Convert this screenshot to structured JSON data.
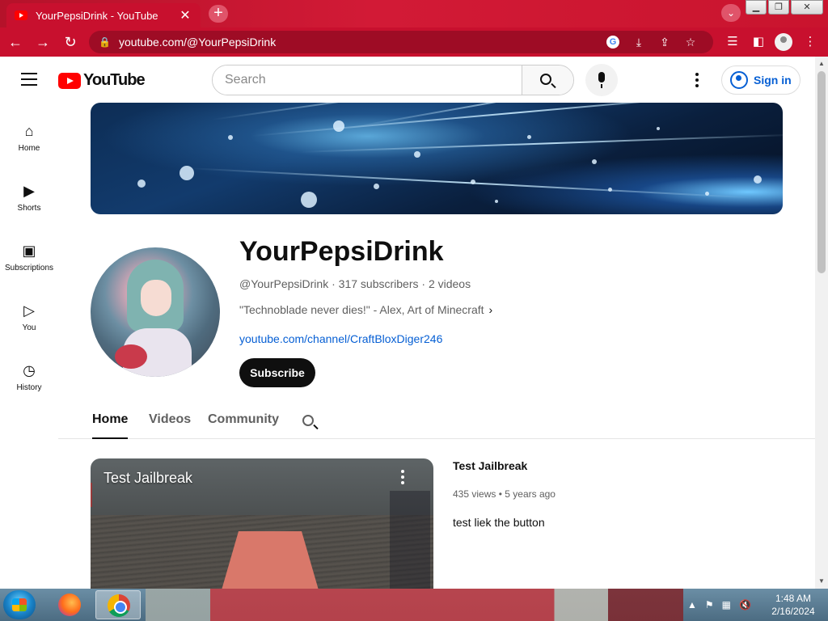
{
  "browser": {
    "tab_title": "YourPepsiDrink - YouTube",
    "tab_close": "✕",
    "new_tab": "+",
    "tab_search": "⌄",
    "window_minimize": "▁",
    "window_restore": "❐",
    "window_close": "✕",
    "url": "youtube.com/@YourPepsiDrink",
    "back": "←",
    "forward": "→",
    "reload": "↻"
  },
  "youtube": {
    "logo_text": "YouTube",
    "search_placeholder": "Search",
    "sign_in": "Sign in",
    "sidebar": [
      {
        "label": "Home",
        "icon": "⌂"
      },
      {
        "label": "Shorts",
        "icon": "▶"
      },
      {
        "label": "Subscriptions",
        "icon": "▣"
      },
      {
        "label": "You",
        "icon": "▷"
      },
      {
        "label": "History",
        "icon": "◷"
      }
    ],
    "channel": {
      "name": "YourPepsiDrink",
      "handle": "@YourPepsiDrink",
      "subscribers": "317 subscribers",
      "videos": "2 videos",
      "separator": "·",
      "description": "\"Technoblade never dies!\" - Alex, Art of Minecraft",
      "more": "›",
      "link": "youtube.com/channel/CraftBloxDiger246",
      "subscribe_label": "Subscribe"
    },
    "tabs": [
      "Home",
      "Videos",
      "Community"
    ],
    "featured_video": {
      "thumbnail_title": "Test Jailbreak",
      "title": "Test Jailbreak",
      "views": "435 views",
      "age": "5 years ago",
      "bullet": "•",
      "description": "test liek the button"
    }
  },
  "taskbar": {
    "time": "1:48 AM",
    "date": "2/16/2024",
    "tray_up": "▲",
    "tray_flag": "⚑",
    "tray_network": "▦",
    "tray_volume": "🔇"
  },
  "colors": {
    "browser_accent": "#c8102e",
    "youtube_red": "#ff0000",
    "link_blue": "#065fd4"
  }
}
